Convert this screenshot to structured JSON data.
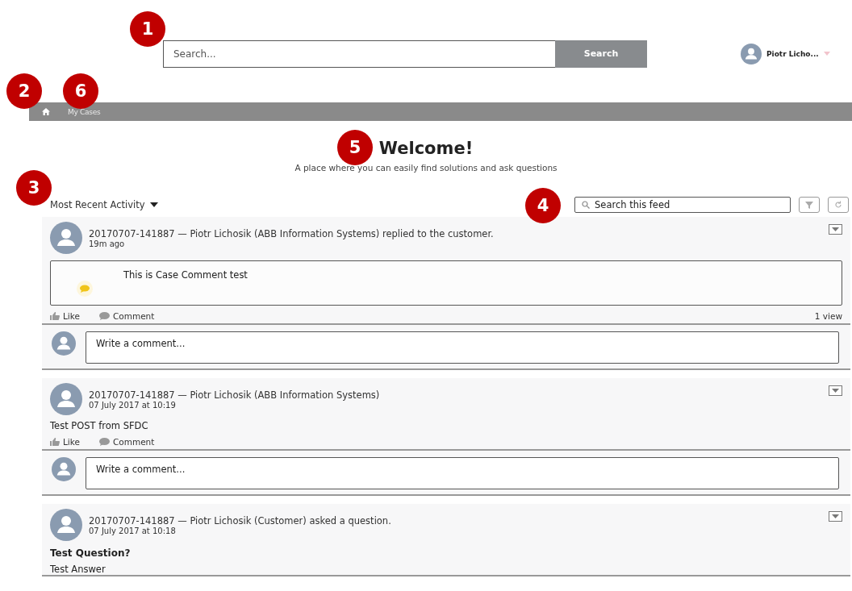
{
  "header": {
    "search_placeholder": "Search...",
    "search_button": "Search",
    "user_name": "Piotr Licho..."
  },
  "breadcrumb": {
    "items": [
      "My Cases"
    ]
  },
  "welcome": {
    "title": "Welcome!",
    "subtitle": "A place where you can easily find solutions and ask questions"
  },
  "feed_toolbar": {
    "sort_label": "Most Recent Activity",
    "search_placeholder": "Search this feed"
  },
  "posts": [
    {
      "kind": "case_comment",
      "header": "20170707-141887 — Piotr Lichosik (ABB Information Systems) replied to the customer.",
      "time": "19m ago",
      "body": "This is Case Comment test",
      "like": "Like",
      "comment": "Comment",
      "views": "1 view",
      "comment_placeholder": "Write a comment..."
    },
    {
      "kind": "post",
      "header": "20170707-141887 — Piotr Lichosik (ABB Information Systems)",
      "time": "07 July 2017 at 10:19",
      "body": "Test POST from SFDC",
      "like": "Like",
      "comment": "Comment",
      "comment_placeholder": "Write a comment..."
    },
    {
      "kind": "question",
      "header": "20170707-141887 — Piotr Lichosik (Customer) asked a question.",
      "time": "07 July 2017 at 10:18",
      "title": "Test Question?",
      "body": "Test Answer"
    }
  ],
  "annotations": [
    "1",
    "2",
    "6",
    "5",
    "3",
    "4"
  ]
}
